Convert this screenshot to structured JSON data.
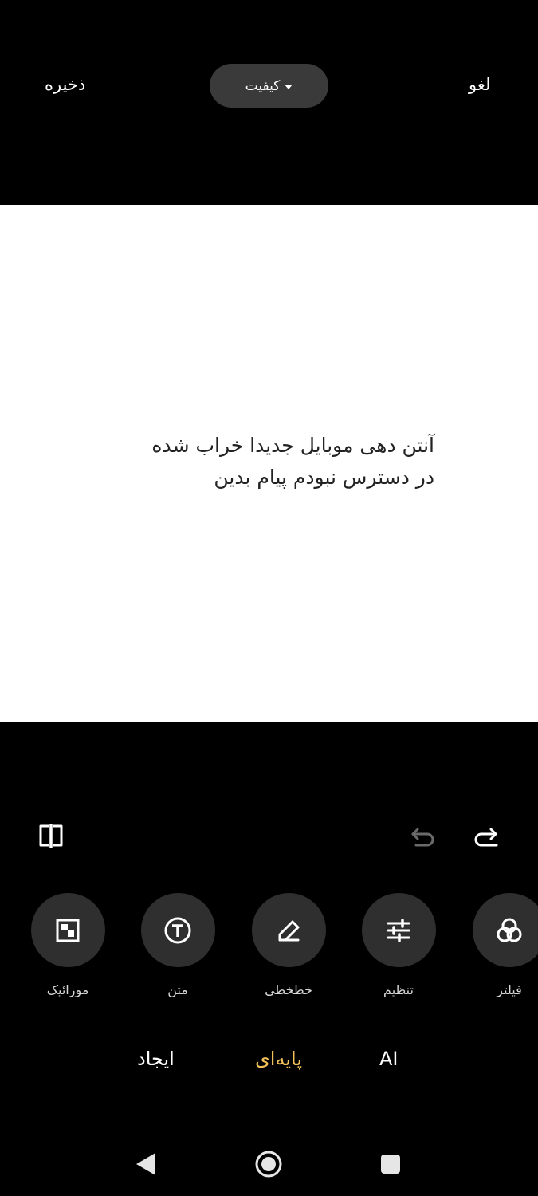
{
  "header": {
    "save_label": "ذخیره",
    "quality_label": "کیفیت",
    "cancel_label": "لغو"
  },
  "canvas": {
    "message": "آنتن دهی موبایل جدیدا خراب شده\nدر دسترس نبودم پیام بدین"
  },
  "edit_toolbar": {
    "icons": [
      "compare-icon",
      "undo-icon",
      "redo-icon"
    ]
  },
  "tools": [
    {
      "label": "موزائیک",
      "icon": "mosaic-icon"
    },
    {
      "label": "متن",
      "icon": "text-icon"
    },
    {
      "label": "خطخطی",
      "icon": "pencil-icon"
    },
    {
      "label": "تنظیم",
      "icon": "sliders-icon"
    },
    {
      "label": "فیلتر",
      "icon": "filter-icon"
    }
  ],
  "modes": [
    {
      "label": "ایجاد",
      "active": false
    },
    {
      "label": "پایه‌ای",
      "active": true
    },
    {
      "label": "AI",
      "active": false
    }
  ],
  "colors": {
    "background": "#000000",
    "canvas": "#ffffff",
    "tool_circle": "#2f2f2f",
    "active_mode": "#f3c25b"
  }
}
